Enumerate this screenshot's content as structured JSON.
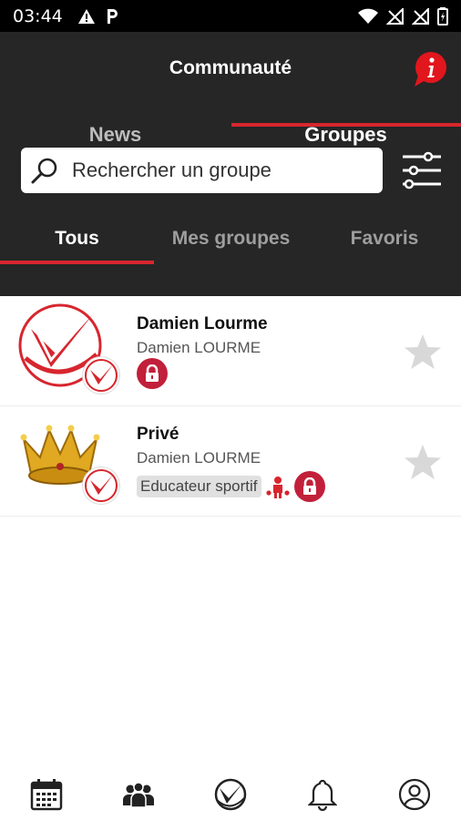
{
  "status_bar": {
    "time": "03:44",
    "left_icons": [
      "warning-icon",
      "parking-icon"
    ],
    "right_icons": [
      "wifi-icon",
      "no-signal-icon",
      "no-signal-icon",
      "battery-icon"
    ]
  },
  "header": {
    "title": "Communauté",
    "info_icon": "info-icon"
  },
  "main_tabs": [
    {
      "label": "News",
      "active": false
    },
    {
      "label": "Groupes",
      "active": true
    }
  ],
  "search": {
    "placeholder": "Rechercher un groupe"
  },
  "sub_tabs": [
    {
      "label": "Tous",
      "active": true
    },
    {
      "label": "Mes groupes",
      "active": false
    },
    {
      "label": "Favoris",
      "active": false
    }
  ],
  "groups": [
    {
      "name": "Damien Lourme",
      "owner": "Damien LOURME",
      "tags": [],
      "locked": true,
      "favorite": false,
      "avatar": "club-logo"
    },
    {
      "name": "Privé",
      "owner": "Damien LOURME",
      "tags": [
        "Educateur sportif"
      ],
      "locked": true,
      "favorite": false,
      "avatar": "crown"
    }
  ],
  "bottom_nav": [
    {
      "icon": "calendar-icon",
      "active": false
    },
    {
      "icon": "groups-icon",
      "active": true
    },
    {
      "icon": "club-logo-icon",
      "active": false
    },
    {
      "icon": "bell-icon",
      "active": false
    },
    {
      "icon": "profile-icon",
      "active": false
    }
  ],
  "colors": {
    "accent": "#d7262e",
    "header_bg": "#262626",
    "lock_badge": "#c21f3a",
    "star_inactive": "#d8d8d8"
  }
}
